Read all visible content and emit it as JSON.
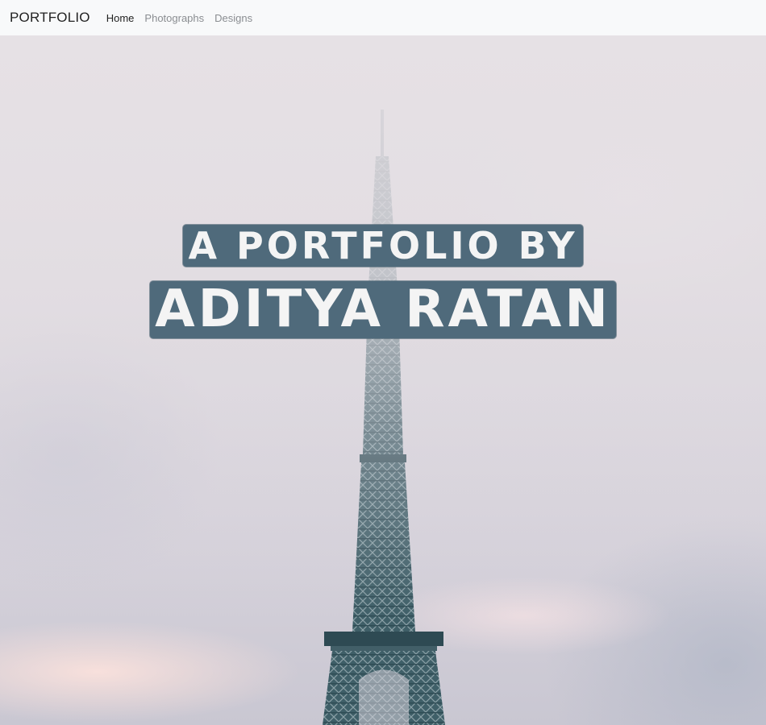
{
  "navbar": {
    "brand": "PORTFOLIO",
    "links": [
      {
        "label": "Home",
        "active": true
      },
      {
        "label": "Photographs",
        "active": false
      },
      {
        "label": "Designs",
        "active": false
      }
    ]
  },
  "hero": {
    "line1": "A PORTFOLIO BY",
    "line2": "ADITYA RATAN",
    "tile_color": "#4f6a7b",
    "image": "eiffel-tower-in-fog"
  }
}
